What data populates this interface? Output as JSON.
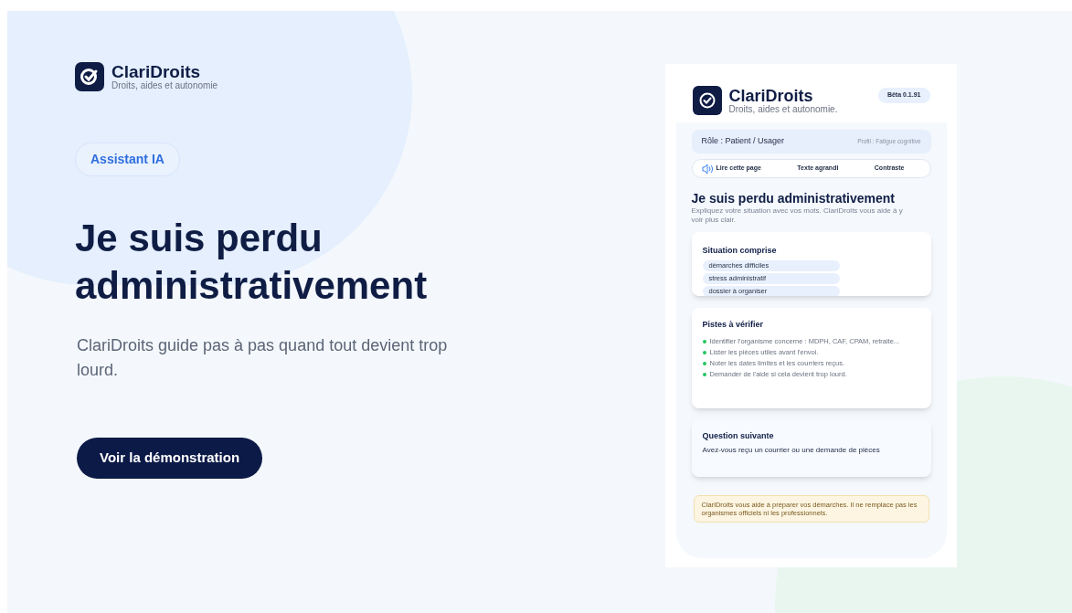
{
  "brand": {
    "name": "ClariDroits",
    "tagline": "Droits, aides et autonomie"
  },
  "badge": "Assistant IA",
  "headline": "Je suis perdu administrativement",
  "lead": "ClariDroits guide pas à pas quand tout devient trop lourd.",
  "cta": "Voir la démonstration",
  "preview": {
    "brand": {
      "name": "ClariDroits",
      "tagline": "Droits, aides et autonomie.",
      "version": "Bêta 0.1.91"
    },
    "role": "Rôle : Patient / Usager",
    "profile": "Profil : Fatigue cognitive",
    "tools": [
      {
        "kind": "audio",
        "label": "Lire cette page"
      },
      {
        "kind": "text",
        "label": "Texte agrandi"
      },
      {
        "kind": "text",
        "label": "Contraste"
      }
    ],
    "title": "Je suis perdu administrativement",
    "intro": "Expliquez votre situation avec vos mots. ClariDroits vous aide à y voir plus clair.",
    "situation": {
      "title": "Situation comprise",
      "tags": [
        "démarches difficiles",
        "stress administratif",
        "dossier à organiser"
      ]
    },
    "leads": {
      "title": "Pistes à vérifier",
      "items": [
        {
          "text": "Identifier l'organisme concerne : MDPH, CAF, CPAM, retraite...",
          "color": "#22c55e"
        },
        {
          "text": "Lister les pièces utiles avant l'envoi.",
          "color": "#22c55e"
        },
        {
          "text": "Noter les dates limites et les courriers reçus.",
          "color": "#22c55e"
        },
        {
          "text": "Demander de l'aide si cela devient trop lourd.",
          "color": "#22c55e"
        }
      ]
    },
    "question": {
      "title": "Question suivante",
      "text": "Avez-vous reçu un courrier ou une demande de pièces"
    },
    "notice": "ClariDroits vous aide à préparer vos démarches. Il ne remplace pas les organismes officiels ni les professionnels."
  }
}
